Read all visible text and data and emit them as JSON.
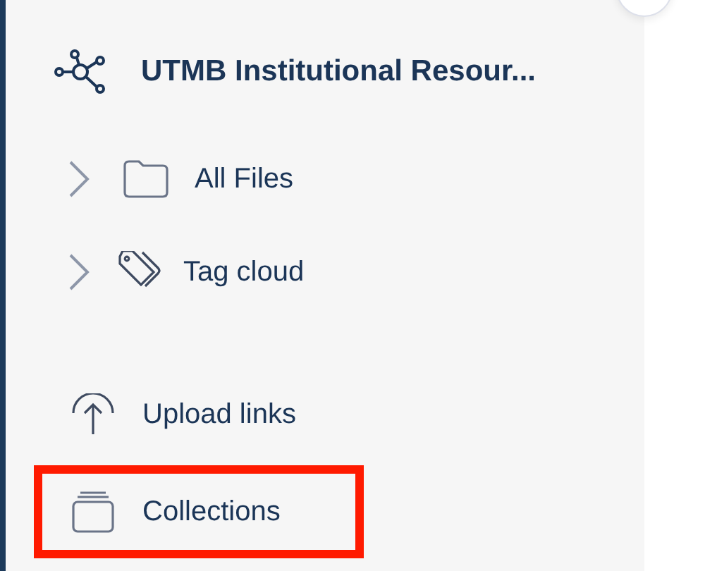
{
  "sidebar": {
    "title": "UTMB Institutional Resour...",
    "tree": [
      {
        "label": "All Files",
        "kind": "folder",
        "expanded": false
      },
      {
        "label": "Tag cloud",
        "kind": "tag",
        "expanded": false
      }
    ],
    "links": [
      {
        "label": "Upload links",
        "kind": "upload",
        "highlighted": false
      },
      {
        "label": "Collections",
        "kind": "collection",
        "highlighted": true
      }
    ]
  }
}
